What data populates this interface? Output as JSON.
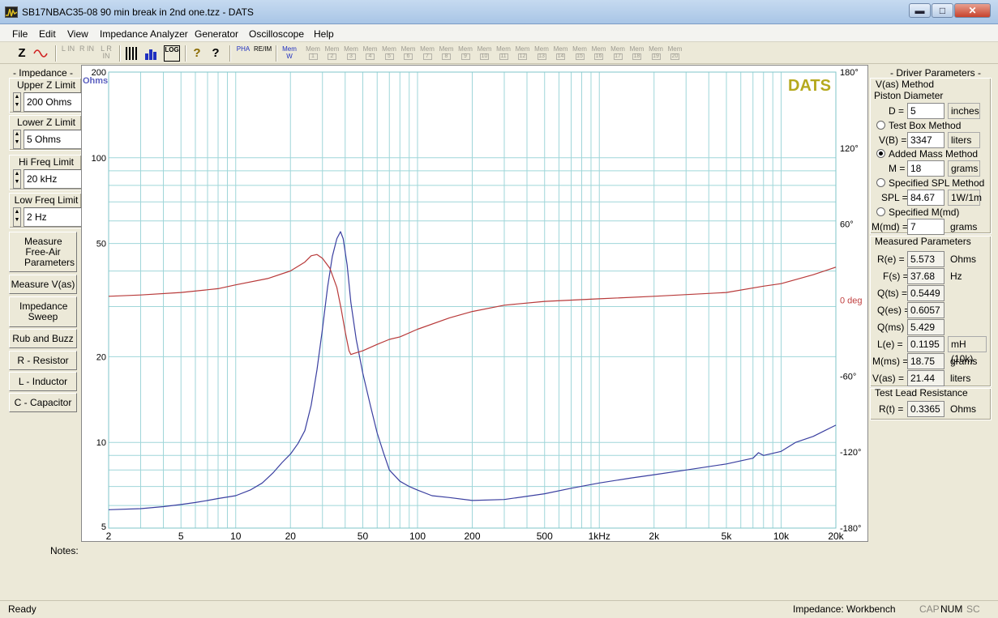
{
  "window": {
    "title": "SB17NBAC35-08 90 min break in 2nd one.tzz - DATS",
    "min_glyph": "▬",
    "max_glyph": "□",
    "close_glyph": "✕"
  },
  "menu": [
    "File",
    "Edit",
    "View",
    "Impedance Analyzer",
    "Generator",
    "Oscilloscope",
    "Help"
  ],
  "toolbar": {
    "z_label": "Z",
    "l_labels": [
      "L IN",
      "R IN",
      "L R IN"
    ],
    "log_label": "LOG",
    "pha_label": "PHA",
    "re_im_label": "RE/IM",
    "mem_w_label": "Mem W",
    "mem_label": "Mem",
    "mem_slots": [
      "1",
      "2",
      "3",
      "4",
      "5",
      "6",
      "7",
      "8",
      "9",
      "10",
      "11",
      "12",
      "13",
      "14",
      "15",
      "16",
      "17",
      "18",
      "19",
      "20"
    ],
    "help_glyph": "?",
    "whatsthis_glyph": "?"
  },
  "left_panel": {
    "header": "- Impedance -",
    "upper_z_label": "Upper Z Limit",
    "upper_z_value": "200 Ohms",
    "lower_z_label": "Lower Z Limit",
    "lower_z_value": "5 Ohms",
    "hi_freq_label": "Hi Freq Limit",
    "hi_freq_value": "20 kHz",
    "low_freq_label": "Low Freq Limit",
    "low_freq_value": "2 Hz",
    "buttons": {
      "measure_free_air": "Measure Free-Air Parameters",
      "measure_vas": "Measure V(as)",
      "impedance_sweep": "Impedance Sweep",
      "rub_and_buzz": "Rub and Buzz",
      "resistor": "R - Resistor",
      "inductor": "L - Inductor",
      "capacitor": "C - Capacitor"
    }
  },
  "chart_data": {
    "type": "line",
    "watermark": "DATS",
    "xscale": "log",
    "xlim": [
      2,
      20000
    ],
    "x_ticks": [
      2,
      5,
      10,
      20,
      50,
      100,
      200,
      500,
      1000,
      2000,
      5000,
      10000,
      20000
    ],
    "x_tick_labels": [
      "2",
      "5",
      "10",
      "20",
      "50",
      "100",
      "200",
      "500",
      "1kHz",
      "2k",
      "5k",
      "10k",
      "20k"
    ],
    "y_left_label": "Ohms",
    "y_left_scale": "log",
    "y_left_lim": [
      5,
      200
    ],
    "y_left_ticks": [
      5,
      10,
      20,
      50,
      100,
      200
    ],
    "y_left_tick_labels": [
      "5",
      "10",
      "20",
      "50",
      "100",
      "200"
    ],
    "y_right_label": "deg",
    "y_right_lim": [
      -180,
      180
    ],
    "y_right_ticks": [
      180,
      120,
      60,
      0,
      -60,
      -120,
      -180
    ],
    "y_right_tick_labels": [
      "180°",
      "120°",
      "60°",
      "0 deg",
      "-60°",
      "-120°",
      "-180°"
    ],
    "grid": true,
    "colors": {
      "impedance": "#3a3fa0",
      "phase": "#b83a3a",
      "watermark": "#b5a91e",
      "ohms_label": "#5a5fc0",
      "deg_label": "#c04040"
    },
    "series": [
      {
        "name": "Impedance",
        "axis": "left",
        "x": [
          2,
          3,
          4,
          5,
          6,
          7,
          8,
          10,
          12,
          14,
          16,
          18,
          20,
          22,
          24,
          26,
          28,
          30,
          32,
          34,
          36,
          37.7,
          39,
          41,
          43,
          46,
          50,
          55,
          60,
          65,
          70,
          80,
          90,
          100,
          120,
          150,
          200,
          300,
          500,
          700,
          1000,
          1500,
          2000,
          3000,
          5000,
          7000,
          7500,
          8000,
          10000,
          12000,
          15000,
          20000
        ],
        "y": [
          5.8,
          5.85,
          5.95,
          6.05,
          6.15,
          6.25,
          6.35,
          6.5,
          6.8,
          7.2,
          7.8,
          8.5,
          9.1,
          9.9,
          11.0,
          13.5,
          18,
          25,
          35,
          45,
          52,
          55,
          52,
          42,
          31,
          23,
          17.5,
          13.5,
          10.8,
          9.2,
          8.0,
          7.3,
          7.0,
          6.8,
          6.5,
          6.4,
          6.25,
          6.3,
          6.6,
          6.9,
          7.2,
          7.5,
          7.7,
          8.0,
          8.4,
          8.8,
          9.2,
          9.0,
          9.3,
          10.0,
          10.5,
          11.5
        ]
      },
      {
        "name": "Phase",
        "axis": "right",
        "x": [
          2,
          3,
          5,
          8,
          10,
          15,
          20,
          24,
          26,
          28,
          30,
          33,
          36,
          38,
          40,
          42,
          43,
          45,
          50,
          60,
          70,
          80,
          100,
          150,
          200,
          300,
          500,
          1000,
          2000,
          5000,
          8000,
          10000,
          15000,
          20000
        ],
        "y": [
          3,
          4,
          6,
          9,
          12,
          17,
          23,
          30,
          35,
          36,
          33,
          25,
          10,
          -7,
          -25,
          -40,
          -43,
          -42,
          -40,
          -35,
          -31,
          -29,
          -23,
          -14,
          -9,
          -4,
          -1,
          1,
          3,
          6,
          11,
          13,
          20,
          26
        ]
      }
    ]
  },
  "notes_label": "Notes:",
  "right_panel": {
    "driver_header": "- Driver Parameters -",
    "vas_method_label": "V(as) Method",
    "piston_diameter_label": "Piston Diameter",
    "d_label": "D =",
    "d_value": "5",
    "d_unit": "inches",
    "test_box_label": "Test Box Method",
    "vb_label": "V(B) =",
    "vb_value": "3347",
    "vb_unit": "liters",
    "added_mass_label": "Added Mass Method",
    "m_label": "M =",
    "m_value": "18",
    "m_unit": "grams",
    "spl_method_label": "Specified SPL Method",
    "spl_label": "SPL =",
    "spl_value": "84.67",
    "spl_unit": "1W/1m",
    "mmd_method_label": "Specified M(md)",
    "mmd_label": "M(md) =",
    "mmd_value": "7",
    "mmd_unit": "grams",
    "selected_method": "Added Mass Method",
    "measured_header": "Measured Parameters",
    "measured": [
      {
        "label": "R(e) =",
        "value": "5.573",
        "unit": "Ohms",
        "boxed_unit": false
      },
      {
        "label": "F(s) =",
        "value": "37.68",
        "unit": "Hz",
        "boxed_unit": false
      },
      {
        "label": "Q(ts) =",
        "value": "0.5449",
        "unit": "",
        "boxed_unit": false
      },
      {
        "label": "Q(es) =",
        "value": "0.6057",
        "unit": "",
        "boxed_unit": false
      },
      {
        "label": "Q(ms) =",
        "value": "5.429",
        "unit": "",
        "boxed_unit": false
      },
      {
        "label": "L(e) =",
        "value": "0.1195",
        "unit": "mH (10k)",
        "boxed_unit": true
      },
      {
        "label": "M(ms) =",
        "value": "18.75",
        "unit": "grams",
        "boxed_unit": false
      },
      {
        "label": "V(as) =",
        "value": "21.44",
        "unit": "liters",
        "boxed_unit": false
      }
    ],
    "lead_header": "Test Lead Resistance",
    "rt_label": "R(t) =",
    "rt_value": "0.3365",
    "rt_unit": "Ohms"
  },
  "status": {
    "left": "Ready",
    "mode": "Impedance: Workbench",
    "cap": "CAP",
    "num": "NUM",
    "scrl": "SC"
  }
}
